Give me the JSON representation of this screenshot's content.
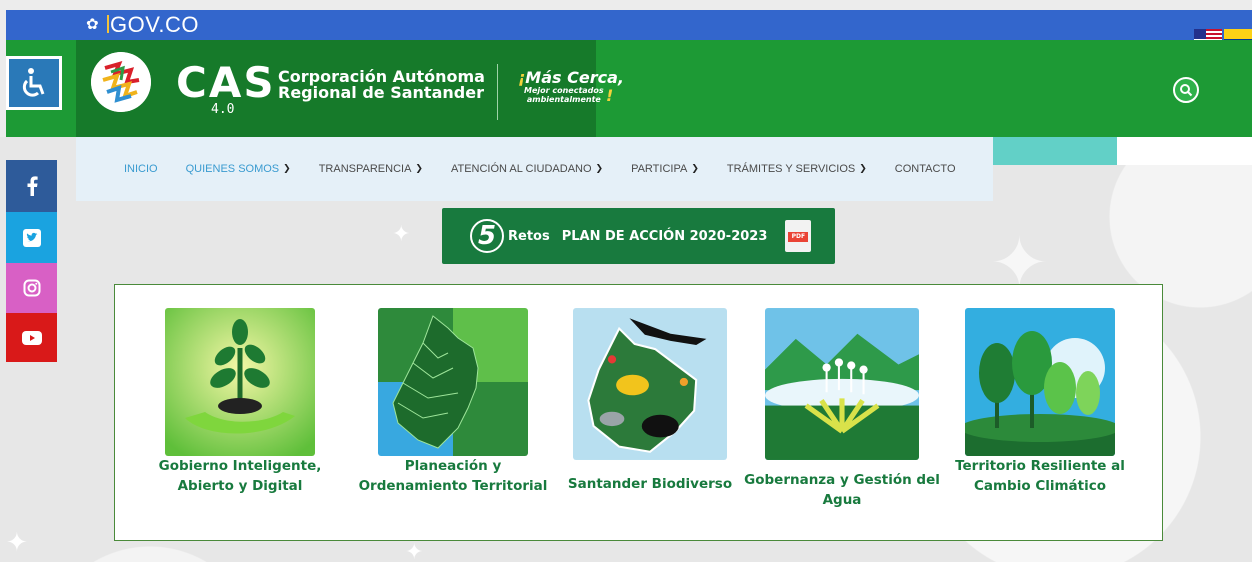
{
  "gov_bar": {
    "label": "GOV.CO"
  },
  "header": {
    "brand": "CAS",
    "version": "4.0",
    "org_line1": "Corporación Autónoma",
    "org_line2": "Regional de Santander",
    "slogan_main": "Más Cerca,",
    "slogan_sub1": "Mejor conectados",
    "slogan_sub2": "ambientalmente"
  },
  "nav": {
    "items": [
      {
        "label": "INICIO",
        "active": true,
        "dropdown": false
      },
      {
        "label": "QUIENES SOMOS",
        "active": false,
        "dropdown": true
      },
      {
        "label": "TRANSPARENCIA",
        "active": false,
        "dropdown": true
      },
      {
        "label": "ATENCIÓN AL CIUDADANO",
        "active": false,
        "dropdown": true
      },
      {
        "label": "PARTICIPA",
        "active": false,
        "dropdown": true
      },
      {
        "label": "TRÁMITES Y SERVICIOS",
        "active": false,
        "dropdown": true
      },
      {
        "label": "CONTACTO",
        "active": false,
        "dropdown": false
      }
    ]
  },
  "social": [
    "facebook-icon",
    "twitter-icon",
    "instagram-icon",
    "youtube-icon"
  ],
  "plan": {
    "number": "5",
    "retos": "Retos",
    "title": "PLAN DE ACCIÓN 2020-2023",
    "pdf_tag": "PDF"
  },
  "cards": [
    {
      "line1": "Gobierno Inteligente,",
      "line2": "Abierto y Digital"
    },
    {
      "line1": "Planeación y",
      "line2": "Ordenamiento Territorial"
    },
    {
      "line1": "Santander Biodiverso",
      "line2": ""
    },
    {
      "line1": "Gobernanza y Gestión del",
      "line2": "Agua"
    },
    {
      "line1": "Territorio Resiliente al",
      "line2": "Cambio Climático"
    }
  ],
  "colors": {
    "gov_blue": "#3366cc",
    "header_green": "#1d9a35",
    "dark_green": "#187a3e",
    "nav_bg": "#e5f0f8",
    "active_link": "#3a9bd0"
  }
}
